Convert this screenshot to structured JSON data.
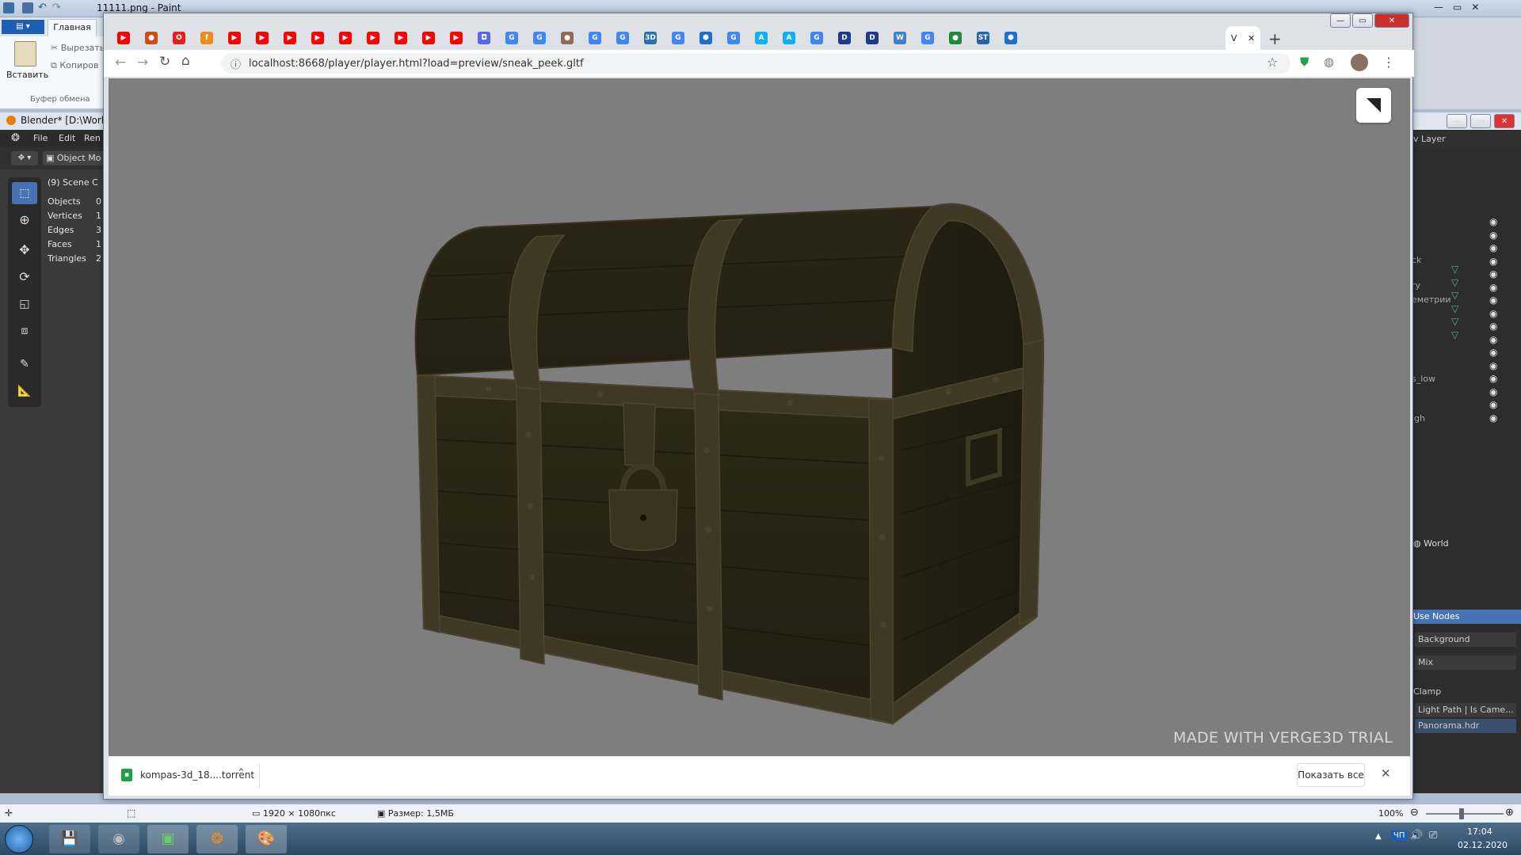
{
  "paint": {
    "title": "11111.png - Paint",
    "tab_home": "Главная",
    "paste_label": "Вставить",
    "cut_label": "Вырезать",
    "copy_label": "Копиров",
    "clipboard_group": "Буфер обмена",
    "status_dimensions": "1920 × 1080пкс",
    "status_size": "Размер: 1,5МБ",
    "zoom": "100%"
  },
  "blender": {
    "title": "Blender* [D:\\Work",
    "menu": [
      "File",
      "Edit",
      "Ren"
    ],
    "mode": "Object Mo",
    "scene": "(9) Scene C",
    "stats": [
      {
        "label": "Objects",
        "value": "0"
      },
      {
        "label": "Vertices",
        "value": "1"
      },
      {
        "label": "Edges",
        "value": "3"
      },
      {
        "label": "Faces",
        "value": "1"
      },
      {
        "label": "Triangles",
        "value": "2"
      }
    ],
    "right": {
      "layer": "v Layer",
      "outliner_fragments": [
        "ck",
        "ry",
        "еметрии",
        "s_low",
        "igh"
      ],
      "world": "World",
      "use_nodes": "Use Nodes",
      "background": "Background",
      "mix": "Mix",
      "clamp": "Clamp",
      "light_path": "Light Path | Is Came...",
      "panorama": "Panorama.hdr"
    }
  },
  "chrome": {
    "url": "localhost:8668/player/player.html?load=preview/sneak_peek.gltf",
    "active_tab": "V",
    "tabs": [
      {
        "icon": "youtube-icon",
        "color": "#ff0000",
        "glyph": "▶"
      },
      {
        "icon": "pizza-icon",
        "color": "#d14a1a",
        "glyph": "●"
      },
      {
        "icon": "opera-icon",
        "color": "#e52020",
        "glyph": "O"
      },
      {
        "icon": "orange-icon",
        "color": "#f08c1a",
        "glyph": "f"
      },
      {
        "icon": "youtube-icon",
        "color": "#ff0000",
        "glyph": "▶"
      },
      {
        "icon": "youtube-icon",
        "color": "#ff0000",
        "glyph": "▶"
      },
      {
        "icon": "youtube-icon",
        "color": "#ff0000",
        "glyph": "▶"
      },
      {
        "icon": "youtube-icon",
        "color": "#ff0000",
        "glyph": "▶"
      },
      {
        "icon": "youtube-icon",
        "color": "#ff0000",
        "glyph": "▶"
      },
      {
        "icon": "youtube-icon",
        "color": "#ff0000",
        "glyph": "▶"
      },
      {
        "icon": "youtube-icon",
        "color": "#ff0000",
        "glyph": "▶"
      },
      {
        "icon": "youtube-icon",
        "color": "#ff0000",
        "glyph": "▶"
      },
      {
        "icon": "youtube-icon",
        "color": "#ff0000",
        "glyph": "▶"
      },
      {
        "icon": "discord-icon",
        "color": "#5865f2",
        "glyph": "◘"
      },
      {
        "icon": "google-icon",
        "color": "#4285f4",
        "glyph": "G"
      },
      {
        "icon": "google-icon",
        "color": "#4285f4",
        "glyph": "G"
      },
      {
        "icon": "circle-icon",
        "color": "#8a6e5a",
        "glyph": "●"
      },
      {
        "icon": "google-icon",
        "color": "#4285f4",
        "glyph": "G"
      },
      {
        "icon": "google-icon",
        "color": "#4285f4",
        "glyph": "G"
      },
      {
        "icon": "3d-icon",
        "color": "#2a6fb0",
        "glyph": "3D"
      },
      {
        "icon": "google-icon",
        "color": "#4285f4",
        "glyph": "G"
      },
      {
        "icon": "hex-icon",
        "color": "#1a6fd0",
        "glyph": "⬢"
      },
      {
        "icon": "google-icon",
        "color": "#4285f4",
        "glyph": "G"
      },
      {
        "icon": "artstation-icon",
        "color": "#13aff0",
        "glyph": "A"
      },
      {
        "icon": "artstation-icon",
        "color": "#13aff0",
        "glyph": "A"
      },
      {
        "icon": "google-icon",
        "color": "#4285f4",
        "glyph": "G"
      },
      {
        "icon": "d-icon",
        "color": "#1e3a8a",
        "glyph": "D"
      },
      {
        "icon": "d-icon",
        "color": "#1e3a8a",
        "glyph": "D"
      },
      {
        "icon": "w-icon",
        "color": "#3b82c4",
        "glyph": "W"
      },
      {
        "icon": "google-icon",
        "color": "#4285f4",
        "glyph": "G"
      },
      {
        "icon": "g-green-icon",
        "color": "#1f8a3b",
        "glyph": "●"
      },
      {
        "icon": "st-icon",
        "color": "#2563a8",
        "glyph": "ST"
      },
      {
        "icon": "hex-icon",
        "color": "#1a6fd0",
        "glyph": "⬢"
      }
    ],
    "watermark": "MADE WITH VERGE3D TRIAL",
    "download_file": "kompas-3d_18....torrent",
    "show_all": "Показать все"
  },
  "taskbar": {
    "time": "17:04",
    "date": "02.12.2020",
    "lang": "ЧП"
  }
}
